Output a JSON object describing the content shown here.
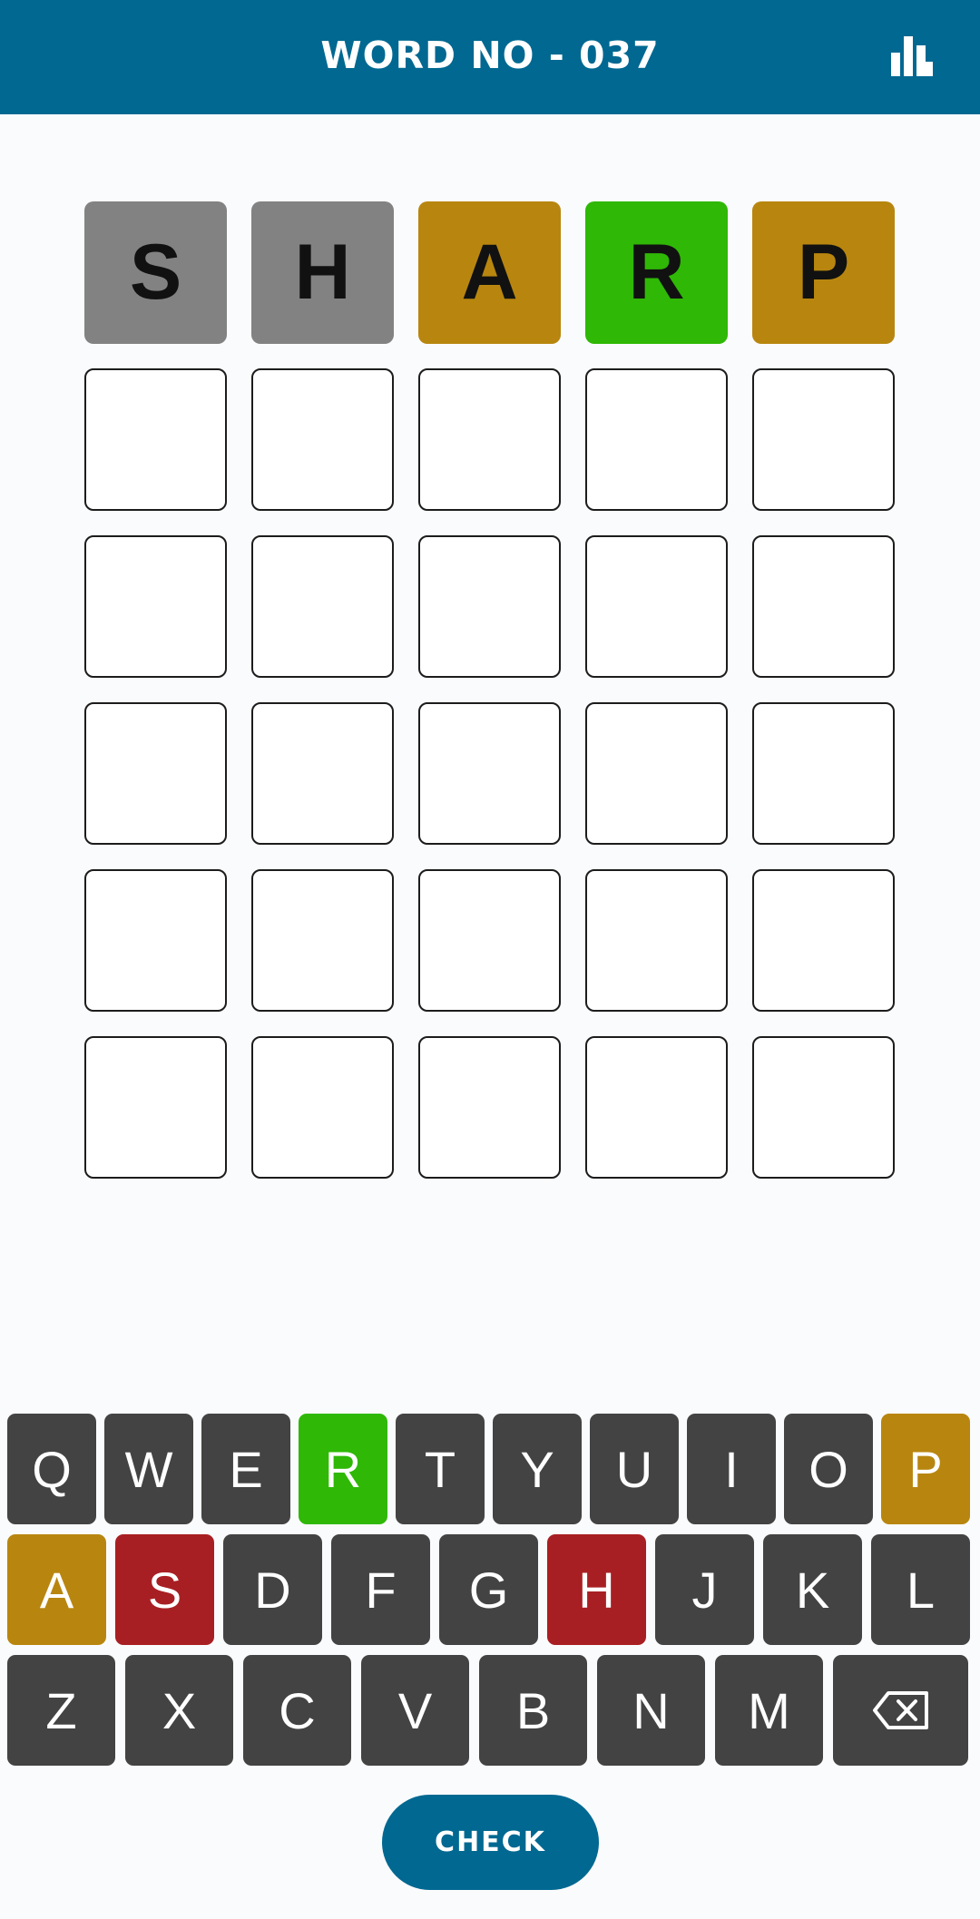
{
  "header": {
    "title": "WORD NO - 037",
    "stats_icon": "bar-chart-icon",
    "background": "#016891"
  },
  "colors": {
    "absent_tile": "#828282",
    "present": "#b8860f",
    "correct": "#2fb806",
    "absent_key": "#a81f23",
    "key_default": "#434343"
  },
  "board": {
    "rows": [
      [
        {
          "letter": "S",
          "state": "absent"
        },
        {
          "letter": "H",
          "state": "absent"
        },
        {
          "letter": "A",
          "state": "present"
        },
        {
          "letter": "R",
          "state": "correct"
        },
        {
          "letter": "P",
          "state": "present"
        }
      ],
      [
        {
          "letter": "",
          "state": "empty"
        },
        {
          "letter": "",
          "state": "empty"
        },
        {
          "letter": "",
          "state": "empty"
        },
        {
          "letter": "",
          "state": "empty"
        },
        {
          "letter": "",
          "state": "empty"
        }
      ],
      [
        {
          "letter": "",
          "state": "empty"
        },
        {
          "letter": "",
          "state": "empty"
        },
        {
          "letter": "",
          "state": "empty"
        },
        {
          "letter": "",
          "state": "empty"
        },
        {
          "letter": "",
          "state": "empty"
        }
      ],
      [
        {
          "letter": "",
          "state": "empty"
        },
        {
          "letter": "",
          "state": "empty"
        },
        {
          "letter": "",
          "state": "empty"
        },
        {
          "letter": "",
          "state": "empty"
        },
        {
          "letter": "",
          "state": "empty"
        }
      ],
      [
        {
          "letter": "",
          "state": "empty"
        },
        {
          "letter": "",
          "state": "empty"
        },
        {
          "letter": "",
          "state": "empty"
        },
        {
          "letter": "",
          "state": "empty"
        },
        {
          "letter": "",
          "state": "empty"
        }
      ],
      [
        {
          "letter": "",
          "state": "empty"
        },
        {
          "letter": "",
          "state": "empty"
        },
        {
          "letter": "",
          "state": "empty"
        },
        {
          "letter": "",
          "state": "empty"
        },
        {
          "letter": "",
          "state": "empty"
        }
      ]
    ]
  },
  "keyboard": {
    "row1": [
      {
        "label": "Q",
        "state": "default"
      },
      {
        "label": "W",
        "state": "default"
      },
      {
        "label": "E",
        "state": "default"
      },
      {
        "label": "R",
        "state": "correct"
      },
      {
        "label": "T",
        "state": "default"
      },
      {
        "label": "Y",
        "state": "default"
      },
      {
        "label": "U",
        "state": "default"
      },
      {
        "label": "I",
        "state": "default"
      },
      {
        "label": "O",
        "state": "default"
      },
      {
        "label": "P",
        "state": "present"
      }
    ],
    "row2": [
      {
        "label": "A",
        "state": "present"
      },
      {
        "label": "S",
        "state": "absent"
      },
      {
        "label": "D",
        "state": "default"
      },
      {
        "label": "F",
        "state": "default"
      },
      {
        "label": "G",
        "state": "default"
      },
      {
        "label": "H",
        "state": "absent"
      },
      {
        "label": "J",
        "state": "default"
      },
      {
        "label": "K",
        "state": "default"
      },
      {
        "label": "L",
        "state": "default"
      }
    ],
    "row3": [
      {
        "label": "Z",
        "state": "default"
      },
      {
        "label": "X",
        "state": "default"
      },
      {
        "label": "C",
        "state": "default"
      },
      {
        "label": "V",
        "state": "default"
      },
      {
        "label": "B",
        "state": "default"
      },
      {
        "label": "N",
        "state": "default"
      },
      {
        "label": "M",
        "state": "default"
      }
    ],
    "backspace_icon": "backspace-icon"
  },
  "check_button": {
    "label": "CHECK"
  }
}
